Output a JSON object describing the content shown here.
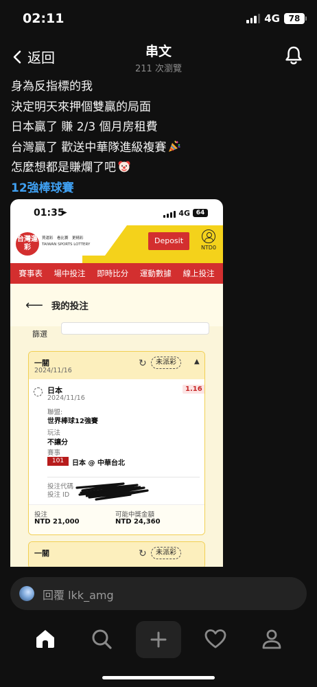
{
  "status_bar": {
    "time": "02:11",
    "network": "4G",
    "battery": "78"
  },
  "header": {
    "back_label": "返回",
    "title": "串文",
    "views": "211 次瀏覽"
  },
  "post": {
    "lines": [
      "身為反指標的我",
      "決定明天來押個雙贏的局面",
      "日本贏了 賺 2/3 個月房租費",
      "台灣贏了 歡送中華隊進級複賽",
      "怎麼想都是賺爛了吧"
    ],
    "tag": "12強棒球賽"
  },
  "embedded": {
    "status": {
      "time": "01:35",
      "network": "4G",
      "battery": "64"
    },
    "logo_text": "台灣運彩",
    "logo_subtitle_1": "買運彩　看比賽　更精彩",
    "logo_subtitle_2": "TAIWAN SPORTS LOTTERY",
    "deposit_label": "Deposit",
    "balance_label": "NTD0",
    "menu": [
      "賽事表",
      "場中投注",
      "即時比分",
      "運動數據",
      "線上投注"
    ],
    "page_title": "我的投注",
    "filter_label": "篩選",
    "bet": {
      "type": "一關",
      "date": "2024/11/16",
      "status": "未派彩",
      "selection": "日本",
      "selection_date": "2024/11/16",
      "odds": "1.16",
      "league_label": "聯盟:",
      "league": "世界棒球12強賽",
      "play_label": "玩法",
      "play": "不讓分",
      "event_label": "賽事",
      "event_number": "101",
      "event_name": "日本 @ 中華台北",
      "code_label": "投注代碼",
      "id_label": "投注 ID",
      "stake_label": "投注",
      "stake": "NTD 21,000",
      "payout_label": "可能中獎金額",
      "payout": "NTD 24,360"
    },
    "bet2": {
      "type": "一關",
      "status": "未派彩"
    }
  },
  "reply": {
    "placeholder": "回覆 lkk_amg"
  },
  "nav": [
    "home-icon",
    "search-icon",
    "plus-icon",
    "heart-icon",
    "profile-icon"
  ]
}
